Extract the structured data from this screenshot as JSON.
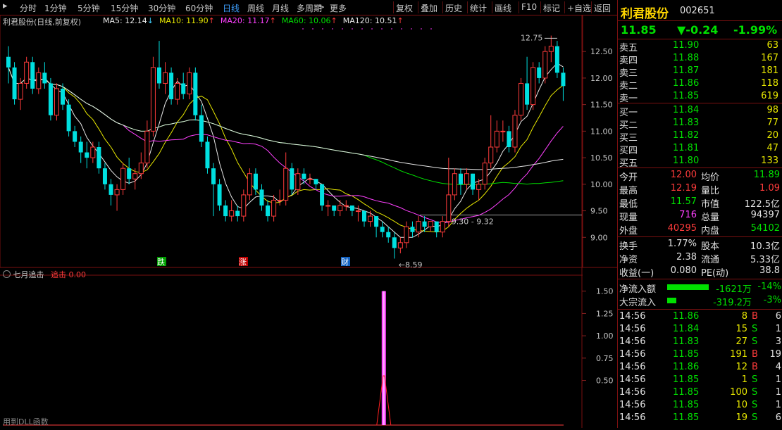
{
  "toolbar": {
    "periods": [
      "分时",
      "1分钟",
      "5分钟",
      "15分钟",
      "30分钟",
      "60分钟",
      "日线",
      "周线",
      "月线",
      "多周期",
      "更多"
    ],
    "active_period": "日线",
    "more_arrow": ">",
    "buttons": [
      "复权",
      "叠加",
      "历史",
      "统计",
      "画线",
      "F10",
      "标记",
      "+自选",
      "返回"
    ]
  },
  "main_chart": {
    "title": "利君股份(日线,前复权)",
    "ma": [
      {
        "label": "MA5: 12.14",
        "arrow": "↓",
        "color": "#e8e8e8"
      },
      {
        "label": "MA10: 11.90",
        "arrow": "↑",
        "color": "#e8e800"
      },
      {
        "label": "MA20: 11.17",
        "arrow": "↑",
        "color": "#ff40ff"
      },
      {
        "label": "MA60: 10.06",
        "arrow": "↑",
        "color": "#00e000"
      },
      {
        "label": "MA120: 10.51",
        "arrow": "↑",
        "color": "#e8e8e8"
      }
    ],
    "y_ticks": [
      "12.50",
      "12.00",
      "11.50",
      "11.00",
      "10.50",
      "10.00",
      "9.50",
      "9.00"
    ],
    "annotations": {
      "high": "12.75",
      "low": "8.59",
      "range": "9.30 - 9.32"
    },
    "markers": [
      "跌",
      "涨",
      "财"
    ]
  },
  "sub_chart": {
    "title": "七月追击",
    "label": "追击",
    "value": "0.00",
    "y_ticks": [
      "1.50",
      "1.25",
      "1.00",
      "0.75",
      "0.50"
    ],
    "footer": "用到DLL函数"
  },
  "quote": {
    "name": "利君股份",
    "code": "002651",
    "price": "11.85",
    "change": "▼-0.24",
    "change_pct": "-1.99%",
    "asks": [
      {
        "label": "卖五",
        "price": "11.90",
        "vol": "63"
      },
      {
        "label": "卖四",
        "price": "11.88",
        "vol": "167"
      },
      {
        "label": "卖三",
        "price": "11.87",
        "vol": "181"
      },
      {
        "label": "卖二",
        "price": "11.86",
        "vol": "118"
      },
      {
        "label": "卖一",
        "price": "11.85",
        "vol": "619"
      }
    ],
    "bids": [
      {
        "label": "买一",
        "price": "11.84",
        "vol": "98"
      },
      {
        "label": "买二",
        "price": "11.83",
        "vol": "77"
      },
      {
        "label": "买三",
        "price": "11.82",
        "vol": "20"
      },
      {
        "label": "买四",
        "price": "11.81",
        "vol": "47"
      },
      {
        "label": "买五",
        "price": "11.80",
        "vol": "133"
      }
    ],
    "stats": [
      {
        "l1": "今开",
        "v1": "12.00",
        "c1": "red",
        "l2": "均价",
        "v2": "11.89",
        "c2": "green"
      },
      {
        "l1": "最高",
        "v1": "12.19",
        "c1": "red",
        "l2": "量比",
        "v2": "1.09",
        "c2": "red"
      },
      {
        "l1": "最低",
        "v1": "11.57",
        "c1": "green",
        "l2": "市值",
        "v2": "122.5亿",
        "c2": "white"
      },
      {
        "l1": "现量",
        "v1": "716",
        "c1": "mag",
        "l2": "总量",
        "v2": "94397",
        "c2": "white"
      },
      {
        "l1": "外盘",
        "v1": "40295",
        "c1": "red",
        "l2": "内盘",
        "v2": "54102",
        "c2": "green"
      }
    ],
    "stats2": [
      {
        "l1": "换手",
        "v1": "1.77%",
        "l2": "股本",
        "v2": "10.3亿"
      },
      {
        "l1": "净资",
        "v1": "2.38",
        "l2": "流通",
        "v2": "5.33亿"
      },
      {
        "l1": "收益(一)",
        "v1": "0.080",
        "l2": "PE(动)",
        "v2": "38.8"
      }
    ],
    "flows": [
      {
        "label": "净流入额",
        "value": "-1621万",
        "pct": "-14%",
        "bar": 0.14
      },
      {
        "label": "大宗流入",
        "value": "-319.2万",
        "pct": "-3%",
        "bar": 0.03
      }
    ],
    "ticks": [
      {
        "t": "14:56",
        "p": "11.86",
        "v": "8",
        "d": "B",
        "n": "6"
      },
      {
        "t": "14:56",
        "p": "11.84",
        "v": "15",
        "d": "S",
        "n": "1"
      },
      {
        "t": "14:56",
        "p": "11.83",
        "v": "27",
        "d": "S",
        "n": "3"
      },
      {
        "t": "14:56",
        "p": "11.85",
        "v": "191",
        "d": "B",
        "n": "19"
      },
      {
        "t": "14:56",
        "p": "11.86",
        "v": "12",
        "d": "B",
        "n": "4"
      },
      {
        "t": "14:56",
        "p": "11.85",
        "v": "1",
        "d": "S",
        "n": "1"
      },
      {
        "t": "14:56",
        "p": "11.85",
        "v": "100",
        "d": "S",
        "n": "1"
      },
      {
        "t": "14:56",
        "p": "11.85",
        "v": "10",
        "d": "S",
        "n": "1"
      },
      {
        "t": "14:56",
        "p": "11.85",
        "v": "19",
        "d": "S",
        "n": "6"
      }
    ]
  },
  "colors": {
    "up": "#ff3b3b",
    "down": "#00e0e0",
    "border": "#7a1010",
    "ma5": "#e8e8e8",
    "ma10": "#e8e800",
    "ma20": "#ff40ff",
    "ma60": "#00e000",
    "ma120": "#e8e8e8"
  },
  "chart_data": {
    "type": "candlestick",
    "ylim": [
      8.5,
      12.9
    ],
    "candles": [
      [
        12.4,
        12.2,
        12.6,
        11.9
      ],
      [
        12.2,
        11.6,
        12.3,
        11.5
      ],
      [
        11.6,
        11.9,
        12.0,
        11.4
      ],
      [
        11.9,
        12.3,
        12.4,
        11.8
      ],
      [
        12.3,
        11.8,
        12.4,
        11.7
      ],
      [
        11.8,
        12.1,
        12.2,
        11.7
      ],
      [
        12.1,
        11.9,
        12.3,
        11.8
      ],
      [
        11.9,
        11.3,
        12.0,
        11.2
      ],
      [
        11.3,
        11.8,
        11.9,
        11.2
      ],
      [
        11.8,
        11.5,
        11.9,
        11.4
      ],
      [
        11.5,
        11.0,
        11.6,
        10.9
      ],
      [
        11.0,
        10.8,
        11.1,
        10.7
      ],
      [
        10.8,
        10.6,
        10.9,
        10.4
      ],
      [
        10.6,
        10.5,
        10.8,
        10.3
      ],
      [
        10.5,
        10.7,
        10.8,
        10.4
      ],
      [
        10.7,
        10.3,
        10.8,
        10.2
      ],
      [
        10.3,
        10.0,
        10.4,
        9.9
      ],
      [
        10.0,
        9.8,
        10.1,
        9.6
      ],
      [
        9.8,
        9.9,
        10.0,
        9.5
      ],
      [
        9.9,
        10.3,
        10.4,
        9.8
      ],
      [
        10.3,
        10.1,
        10.5,
        10.0
      ],
      [
        10.1,
        10.2,
        10.3,
        9.9
      ],
      [
        10.2,
        10.4,
        10.6,
        10.1
      ],
      [
        10.4,
        11.0,
        11.2,
        10.3
      ],
      [
        11.0,
        12.2,
        12.4,
        10.9
      ],
      [
        12.2,
        11.9,
        12.7,
        11.8
      ],
      [
        11.9,
        12.1,
        12.3,
        11.7
      ],
      [
        12.1,
        11.6,
        12.2,
        11.5
      ],
      [
        11.6,
        11.9,
        12.0,
        11.5
      ],
      [
        11.9,
        11.7,
        12.1,
        11.6
      ],
      [
        11.7,
        12.1,
        12.2,
        11.6
      ],
      [
        12.1,
        11.3,
        12.2,
        11.2
      ],
      [
        11.3,
        10.8,
        11.5,
        10.7
      ],
      [
        10.8,
        10.3,
        10.9,
        10.2
      ],
      [
        10.3,
        10.0,
        10.4,
        9.4
      ],
      [
        10.0,
        9.6,
        10.1,
        9.5
      ],
      [
        9.6,
        9.4,
        9.7,
        9.3
      ],
      [
        9.4,
        9.5,
        9.7,
        9.3
      ],
      [
        9.5,
        9.4,
        9.6,
        9.3
      ],
      [
        9.4,
        9.8,
        9.9,
        9.3
      ],
      [
        9.8,
        10.2,
        10.3,
        9.7
      ],
      [
        10.2,
        9.9,
        10.3,
        9.8
      ],
      [
        9.9,
        9.6,
        10.0,
        9.5
      ],
      [
        9.6,
        9.4,
        9.7,
        9.3
      ],
      [
        9.4,
        9.7,
        9.8,
        9.3
      ],
      [
        9.7,
        9.7,
        9.9,
        9.6
      ],
      [
        9.7,
        10.3,
        10.6,
        9.6
      ],
      [
        10.3,
        9.9,
        10.4,
        9.8
      ],
      [
        9.9,
        10.2,
        10.3,
        9.8
      ],
      [
        10.2,
        10.1,
        10.3,
        10.0
      ],
      [
        10.1,
        10.1,
        10.2,
        10.0
      ],
      [
        10.1,
        10.0,
        10.1,
        9.9
      ],
      [
        10.0,
        9.6,
        10.0,
        9.5
      ],
      [
        9.6,
        9.6,
        9.7,
        9.4
      ],
      [
        9.6,
        9.5,
        9.6,
        9.4
      ],
      [
        9.5,
        9.6,
        9.7,
        9.4
      ],
      [
        9.6,
        9.6,
        9.7,
        9.5
      ],
      [
        9.6,
        9.5,
        9.6,
        9.4
      ],
      [
        9.5,
        9.5,
        9.6,
        9.3
      ],
      [
        9.5,
        9.3,
        9.5,
        9.2
      ],
      [
        9.3,
        9.4,
        9.5,
        9.2
      ],
      [
        9.4,
        9.2,
        9.4,
        9.0
      ],
      [
        9.2,
        9.1,
        9.3,
        9.0
      ],
      [
        9.1,
        9.0,
        9.2,
        8.9
      ],
      [
        9.0,
        8.8,
        9.1,
        8.6
      ],
      [
        8.8,
        8.9,
        9.0,
        8.7
      ],
      [
        8.9,
        9.2,
        9.3,
        8.8
      ],
      [
        9.2,
        9.1,
        9.3,
        9.0
      ],
      [
        9.1,
        9.3,
        9.4,
        9.0
      ],
      [
        9.3,
        9.2,
        9.4,
        9.1
      ],
      [
        9.2,
        9.3,
        9.3,
        9.1
      ],
      [
        9.3,
        9.1,
        9.3,
        9.0
      ],
      [
        9.1,
        9.3,
        9.4,
        9.0
      ],
      [
        9.3,
        9.8,
        10.5,
        9.2
      ],
      [
        9.8,
        10.2,
        10.3,
        9.7
      ],
      [
        10.2,
        10.0,
        10.3,
        9.8
      ],
      [
        10.0,
        10.2,
        10.3,
        9.9
      ],
      [
        10.2,
        9.9,
        10.2,
        9.8
      ],
      [
        9.9,
        10.0,
        10.1,
        9.7
      ],
      [
        10.0,
        10.4,
        10.5,
        9.9
      ],
      [
        10.4,
        10.7,
        11.3,
        10.3
      ],
      [
        10.7,
        11.0,
        11.2,
        10.6
      ],
      [
        11.0,
        11.0,
        11.2,
        10.8
      ],
      [
        11.0,
        10.7,
        11.1,
        10.6
      ],
      [
        10.7,
        11.3,
        11.4,
        10.6
      ],
      [
        11.3,
        11.9,
        12.0,
        11.2
      ],
      [
        11.9,
        11.5,
        12.4,
        11.4
      ],
      [
        11.5,
        12.2,
        12.3,
        11.4
      ],
      [
        12.2,
        12.0,
        12.3,
        11.9
      ],
      [
        12.0,
        12.5,
        12.6,
        11.9
      ],
      [
        12.5,
        12.6,
        12.8,
        12.3
      ],
      [
        12.6,
        12.1,
        12.7,
        12.0
      ],
      [
        12.1,
        11.85,
        12.2,
        11.57
      ]
    ],
    "signal": {
      "index": 64,
      "value": 1.5
    },
    "sub_ylim": [
      0,
      1.6
    ]
  }
}
